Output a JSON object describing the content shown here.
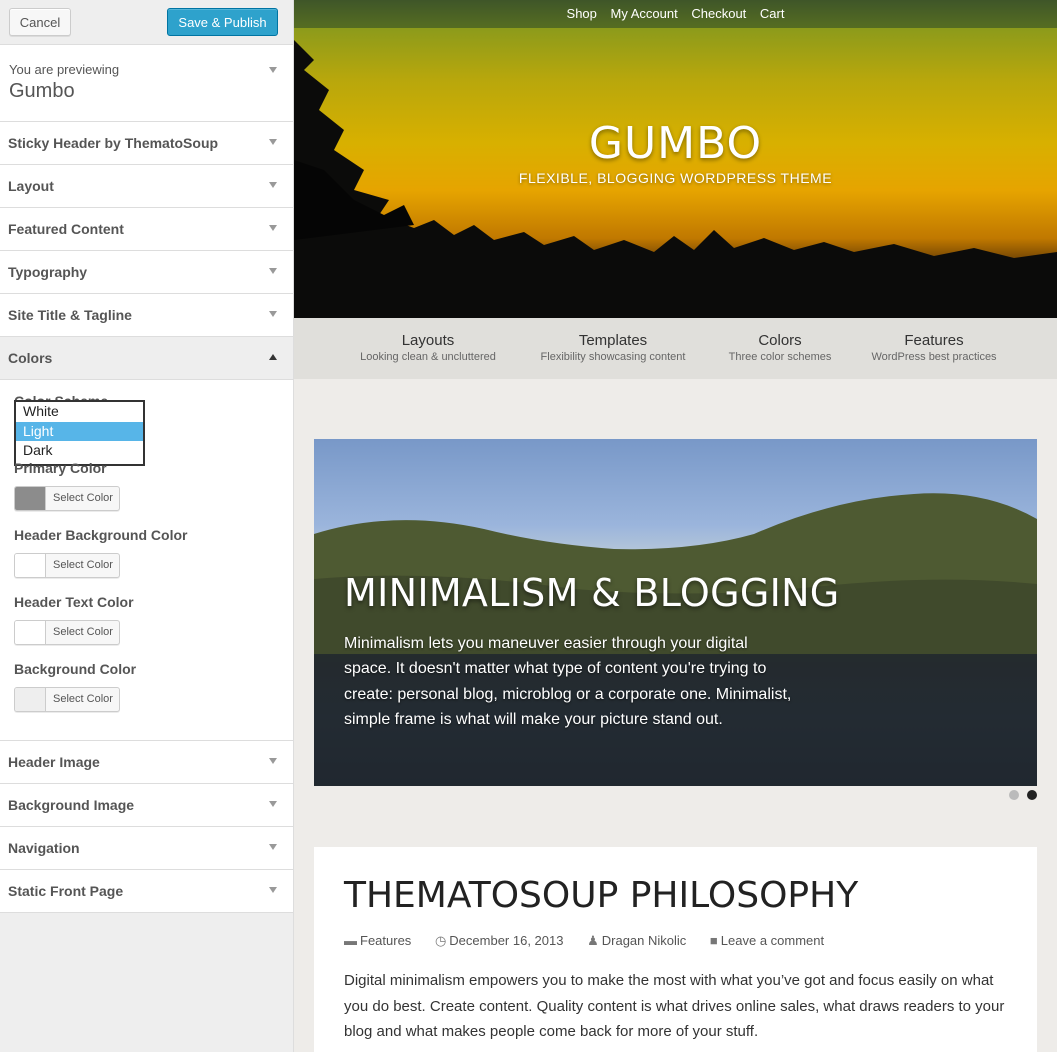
{
  "actions": {
    "cancel": "Cancel",
    "publish": "Save & Publish"
  },
  "preview_info": {
    "label": "You are previewing",
    "theme": "Gumbo"
  },
  "sections_top": [
    "Sticky Header by ThematoSoup",
    "Layout",
    "Featured Content",
    "Typography",
    "Site Title & Tagline"
  ],
  "colors_section": {
    "title": "Colors",
    "scheme_label": "Color Scheme",
    "scheme_options": [
      "White",
      "Light",
      "Dark"
    ],
    "scheme_selected": "Light",
    "controls": [
      {
        "label": "Primary Color",
        "button": "Select Color",
        "swatch": "#8c8c8c"
      },
      {
        "label": "Header Background Color",
        "button": "Select Color",
        "swatch": "#ffffff"
      },
      {
        "label": "Header Text Color",
        "button": "Select Color",
        "swatch": "#ffffff"
      },
      {
        "label": "Background Color",
        "button": "Select Color",
        "swatch": "#eeeeee"
      }
    ]
  },
  "sections_bottom": [
    "Header Image",
    "Background Image",
    "Navigation",
    "Static Front Page"
  ],
  "site": {
    "nav": [
      "Shop",
      "My Account",
      "Checkout",
      "Cart"
    ],
    "title": "GUMBO",
    "tagline": "FLEXIBLE, BLOGGING WORDPRESS THEME",
    "features": [
      {
        "title": "Layouts",
        "subtitle": "Looking clean & uncluttered"
      },
      {
        "title": "Templates",
        "subtitle": "Flexibility showcasing content"
      },
      {
        "title": "Colors",
        "subtitle": "Three color schemes"
      },
      {
        "title": "Features",
        "subtitle": "WordPress best practices"
      }
    ],
    "slide": {
      "title": "MINIMALISM & BLOGGING",
      "text": "Minimalism lets you maneuver easier through your digital space. It doesn't matter what type of content you're trying to create: personal blog, microblog or a corporate one. Minimalist, simple frame is what will make your picture stand out."
    },
    "post": {
      "title": "THEMATOSOUP PHILOSOPHY",
      "category": "Features",
      "date": "December 16, 2013",
      "author": "Dragan Nikolic",
      "comment_link": "Leave a comment",
      "body": "Digital minimalism empowers you to make the most with what you’ve got and focus easily on what you do best. Create content. Quality content is what drives online sales, what draws readers to your blog and what makes people come back for more of your stuff."
    }
  }
}
